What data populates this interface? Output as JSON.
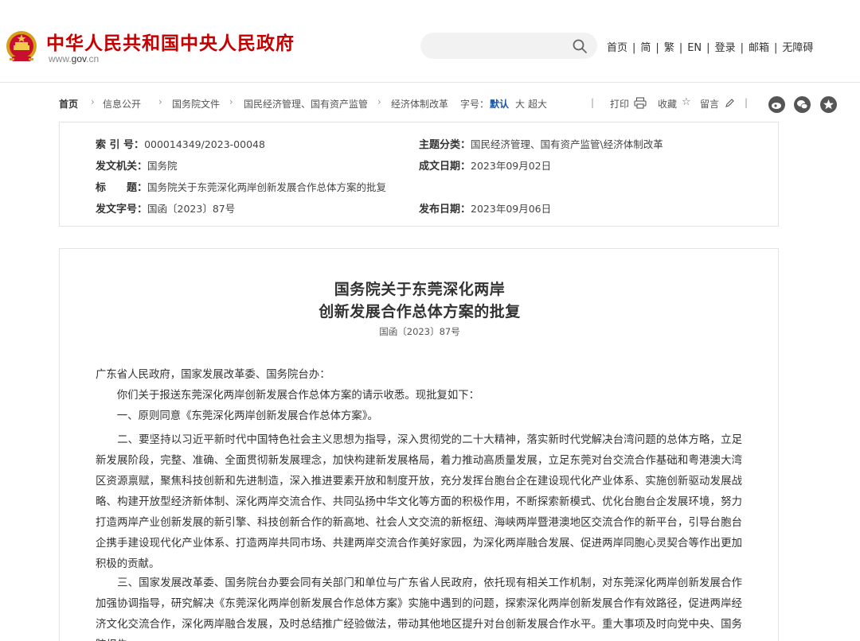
{
  "header": {
    "site_title": "中华人民共和国中央人民政府",
    "site_url_pre": "www.",
    "site_url_bold": "gov",
    "site_url_post": ".cn",
    "search_placeholder": "",
    "nav": [
      "首页",
      "简",
      "繁",
      "EN",
      "登录",
      "邮箱",
      "无障碍"
    ],
    "nav_sep": "|"
  },
  "breadcrumb": {
    "items": [
      "首页",
      "信息公开",
      "国务院文件",
      "国民经济管理、国有资产监管",
      "经济体制改革"
    ],
    "arrow": "›"
  },
  "tools": {
    "font_label": "字号：",
    "font_default": "默认",
    "font_large": "大",
    "font_xlarge": "超大",
    "divider": "|",
    "print": "打印",
    "collect": "收藏",
    "comment": "留言"
  },
  "meta": {
    "index_label": "索 引 号：",
    "index_value": "000014349/2023-00048",
    "topic_label": "主题分类：",
    "topic_value": "国民经济管理、国有资产监管\\经济体制改革",
    "issuer_label": "发文机关：",
    "issuer_value": "国务院",
    "created_label": "成文日期：",
    "created_value": "2023年09月02日",
    "title_label": "标　　题：",
    "title_value": "国务院关于东莞深化两岸创新发展合作总体方案的批复",
    "docno_label": "发文字号：",
    "docno_value": "国函〔2023〕87号",
    "published_label": "发布日期：",
    "published_value": "2023年09月06日"
  },
  "article": {
    "title_line1": "国务院关于东莞深化两岸",
    "title_line2": "创新发展合作总体方案的批复",
    "doc_number": "国函〔2023〕87号",
    "paragraphs": [
      "广东省人民政府，国家发展改革委、国务院台办：",
      "　　你们关于报送东莞深化两岸创新发展合作总体方案的请示收悉。现批复如下：",
      "　　一、原则同意《东莞深化两岸创新发展合作总体方案》。",
      "　　二、要坚持以习近平新时代中国特色社会主义思想为指导，深入贯彻党的二十大精神，落实新时代党解决台湾问题的总体方略，立足新发展阶段，完整、准确、全面贯彻新发展理念，加快构建新发展格局，着力推动高质量发展，立足东莞对台交流合作基础和粤港澳大湾区资源禀赋，聚焦科技创新和先进制造，深入推进要素开放和制度开放，充分发挥台胞台企在建设现代化产业体系、实施创新驱动发展战略、构建开放型经济新体制、深化两岸交流合作、共同弘扬中华文化等方面的积极作用，不断探索新模式、优化台胞台企发展环境，努力打造两岸产业创新发展的新引擎、科技创新合作的新高地、社会人文交流的新枢纽、海峡两岸暨港澳地区交流合作的新平台，引导台胞台企携手建设现代化产业体系、打造两岸共同市场、共建两岸交流合作美好家园，为深化两岸融合发展、促进两岸同胞心灵契合等作出更加积极的贡献。",
      "　　三、国家发展改革委、国务院台办要会同有关部门和单位与广东省人民政府，依托现有相关工作机制，对东莞深化两岸创新发展合作加强协调指导，研究解决《东莞深化两岸创新发展合作总体方案》实施中遇到的问题，探索深化两岸创新发展合作有效路径，促进两岸经济文化交流合作，深化两岸融合发展，及时总结推广经验做法，带动其他地区提升对台创新发展合作水平。重大事项及时向党中央、国务院报告。"
    ]
  }
}
